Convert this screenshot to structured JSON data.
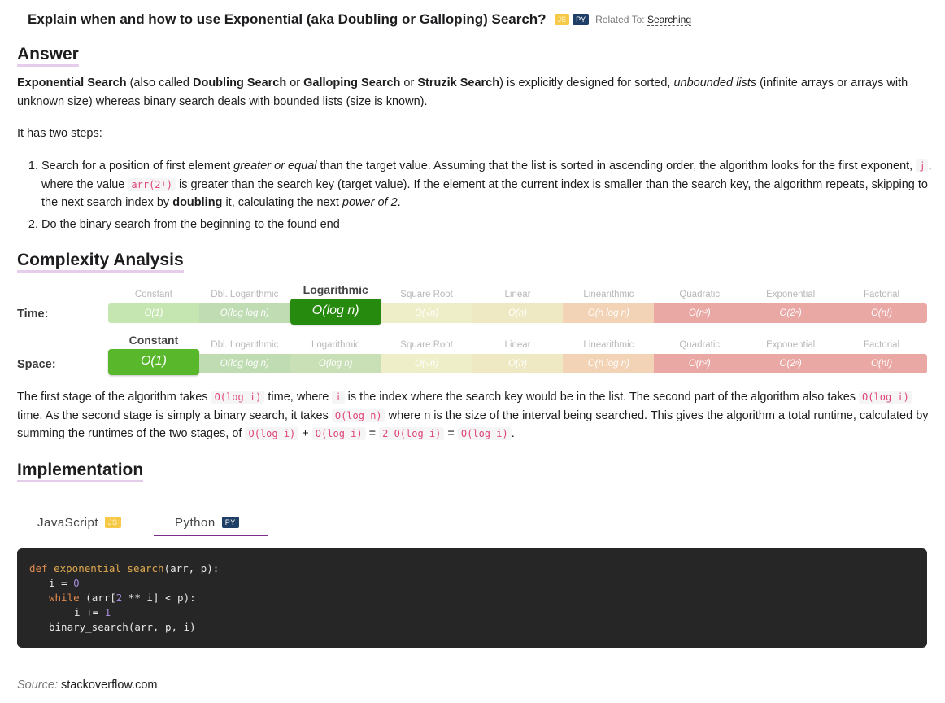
{
  "question": {
    "title": "Explain when and how to use Exponential (aka Doubling or Galloping) Search?",
    "badge_js": "JS",
    "badge_py": "PY",
    "related_prefix": "Related To:",
    "related_link": "Searching"
  },
  "answer": {
    "heading": "Answer",
    "intro_bold_1": "Exponential Search",
    "intro_t1": " (also called ",
    "intro_bold_2": "Doubling Search",
    "intro_t2": " or ",
    "intro_bold_3": "Galloping Search",
    "intro_t3": " or ",
    "intro_bold_4": "Struzik Search",
    "intro_t4": ") is explicitly designed for sorted, ",
    "intro_italic": "unbounded lists",
    "intro_t5": " (infinite arrays or arrays with unknown size) whereas binary search deals with bounded lists (size is known).",
    "two_steps": "It has two steps:",
    "step1_t1": "Search for a position of first element ",
    "step1_italic1": "greater or equal",
    "step1_t2": " than the target value. Assuming that the list is sorted in ascending order, the algorithm looks for the first exponent, ",
    "step1_code1": "j",
    "step1_t3": ", where the value ",
    "step1_code2": "arr(2ʲ)",
    "step1_t4": " is greater than the search key (target value). If the element at the current index is smaller than the search key, the algorithm repeats, skipping to the next search index by ",
    "step1_bold": "doubling",
    "step1_t5": " it, calculating the next ",
    "step1_italic2": "power of 2",
    "step1_t6": ".",
    "step2": "Do the binary search from the beginning to the found end"
  },
  "complexity": {
    "heading": "Complexity Analysis",
    "time_label": "Time:",
    "space_label": "Space:",
    "classes": [
      "Constant",
      "Dbl. Logarithmic",
      "Logarithmic",
      "Square Root",
      "Linear",
      "Linearithmic",
      "Quadratic",
      "Exponential",
      "Factorial"
    ],
    "notations": [
      "O(1)",
      "O(log log n)",
      "O(log n)",
      "O(√n)",
      "O(n)",
      "O(n log n)",
      "O(n²)",
      "O(2ⁿ)",
      "O(n!)"
    ],
    "colors": [
      "#c5e6b0",
      "#bfdcb2",
      "#c9dfb6",
      "#eeeec8",
      "#eee9c3",
      "#f3d3b5",
      "#e9a8a4",
      "#e9a8a4",
      "#e9a8a4"
    ],
    "time_selected": "Logarithmic",
    "space_selected": "Constant",
    "highlight_colors": {
      "Logarithmic": "#268a0e",
      "Constant": "#58b72a"
    },
    "explanation_t1": "The first stage of the algorithm takes ",
    "explanation_c1": "O(log i)",
    "explanation_t2": " time, where ",
    "explanation_c2": "i",
    "explanation_t3": " is the index where the search key would be in the list. The second part of the algorithm also takes ",
    "explanation_c3": "O(log i)",
    "explanation_t4": " time. As the second stage is simply a binary search, it takes ",
    "explanation_c4": "O(log n)",
    "explanation_t5": " where n is the size of the interval being searched. This gives the algorithm a total runtime, calculated by summing the runtimes of the two stages, of ",
    "explanation_c5": "O(log i)",
    "explanation_t6": " + ",
    "explanation_c6": "O(log i)",
    "explanation_t7": " = ",
    "explanation_c7": "2 O(log i)",
    "explanation_t8": " = ",
    "explanation_c8": "O(log i)",
    "explanation_t9": "."
  },
  "implementation": {
    "heading": "Implementation",
    "tabs": [
      {
        "label": "JavaScript",
        "badge": "JS"
      },
      {
        "label": "Python",
        "badge": "PY"
      }
    ],
    "active_tab": "Python",
    "code": {
      "l1_kw": "def",
      "l1_fn": "exponential_search",
      "l1_rest": "(arr, p):",
      "l2_a": "i = ",
      "l2_num": "0",
      "l3_kw": "while",
      "l3_a": " (arr[",
      "l3_num": "2",
      "l3_b": " ** i] < p):",
      "l4_a": "i += ",
      "l4_num": "1",
      "l5": "binary_search(arr, p, i)"
    }
  },
  "source": {
    "label": "Source:",
    "value": "stackoverflow.com"
  }
}
